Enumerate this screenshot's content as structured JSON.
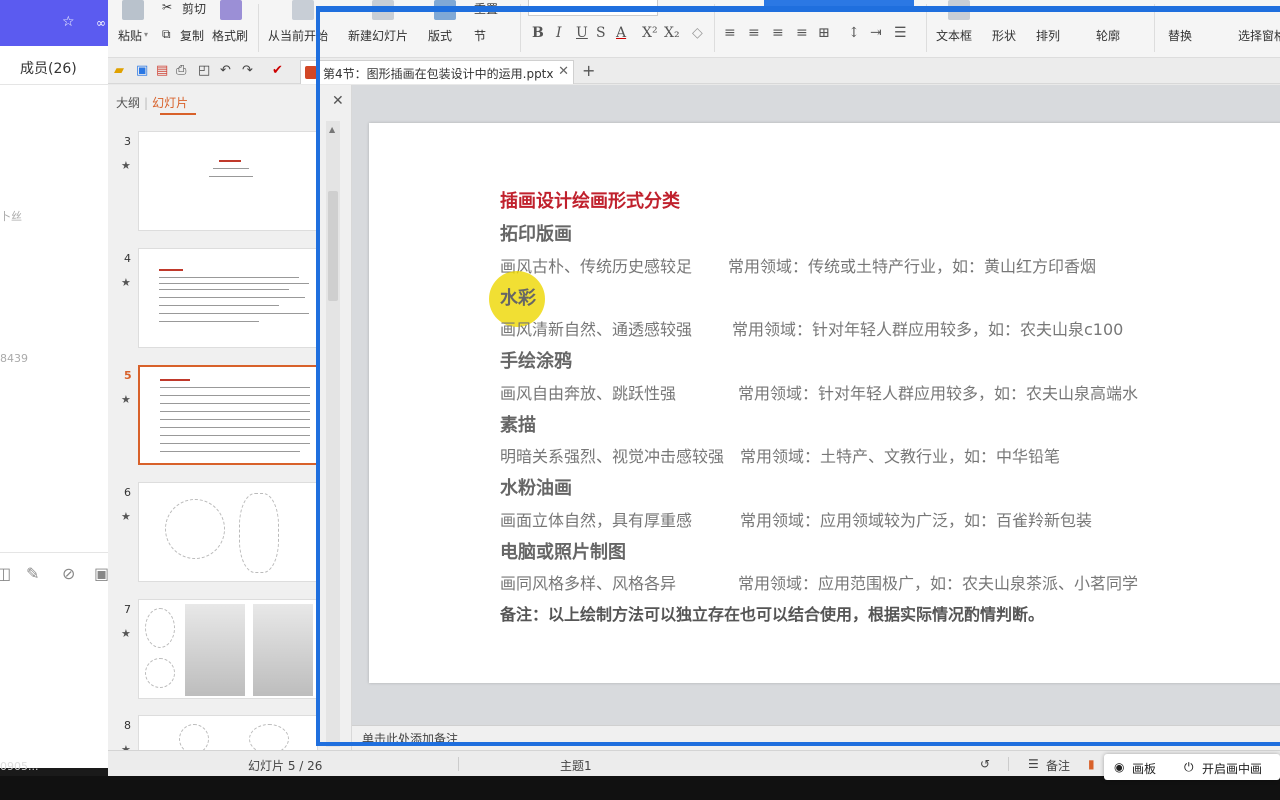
{
  "chat": {
    "members": "成员(26)",
    "frag1": "卜丝",
    "frag2": "8439",
    "bottom": "0905..."
  },
  "ribbon": {
    "paste": "粘贴",
    "cut": "剪切",
    "copy": "复制",
    "format_painter": "格式刷",
    "from_current": "从当前开始",
    "new_slide": "新建幻灯片",
    "layout": "版式",
    "section": "节",
    "reset": "重置",
    "text_box": "文本框",
    "shape": "形状",
    "arrange": "排列",
    "outline": "轮廓",
    "replace": "替换",
    "select_pane": "选择窗格"
  },
  "tabs": {
    "doc_title": "第4节：图形插画在包装设计中的运用.pptx"
  },
  "panel": {
    "tab_outline": "大纲",
    "tab_slides": "幻灯片",
    "thumbnails": [
      {
        "num": "3"
      },
      {
        "num": "4"
      },
      {
        "num": "5"
      },
      {
        "num": "6"
      },
      {
        "num": "7"
      },
      {
        "num": "8"
      }
    ]
  },
  "slide": {
    "title": "插画设计绘画形式分类",
    "items": [
      {
        "heading": "拓印版画",
        "style": "画风古朴、传统历史感较足",
        "field": "常用领域：传统或土特产行业，如：黄山红方印香烟"
      },
      {
        "heading": "水彩",
        "style": "画风清新自然、通透感较强",
        "field": "常用领域：针对年轻人群应用较多，如：农夫山泉c100"
      },
      {
        "heading": "手绘涂鸦",
        "style": "画风自由奔放、跳跃性强",
        "field": "常用领域：针对年轻人群应用较多，如：农夫山泉高端水"
      },
      {
        "heading": "素描",
        "style": "明暗关系强烈、视觉冲击感较强",
        "field": "常用领域：土特产、文教行业，如：中华铅笔"
      },
      {
        "heading": "水粉油画",
        "style": "画面立体自然，具有厚重感",
        "field": "常用领域：应用领域较为广泛，如：百雀羚新包装"
      },
      {
        "heading": "电脑或照片制图",
        "style": "画同风格多样、风格各异",
        "field": "常用领域：应用范围极广，如：农夫山泉茶派、小茗同学"
      }
    ],
    "note": "备注：以上绘制方法可以独立存在也可以结合使用，根据实际情况酌情判断。"
  },
  "notes_placeholder": "单击此处添加备注",
  "status": {
    "slide_counter": "幻灯片 5 / 26",
    "theme": "主题1",
    "notes": "备注"
  },
  "floating": {
    "canvas": "画板",
    "pip": "开启画中画"
  },
  "colors": {
    "accent_orange": "#d8612a",
    "title_red": "#c0212d",
    "overlay_blue": "#1f6fde"
  }
}
